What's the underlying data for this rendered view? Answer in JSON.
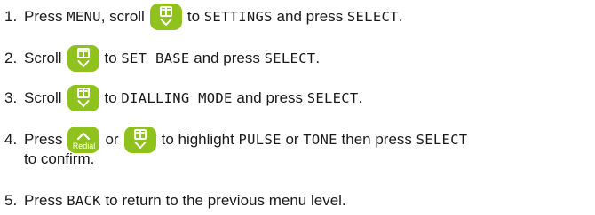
{
  "steps": [
    {
      "number": "1.",
      "t1": "Press ",
      "l1": "MENU",
      "t2": ", scroll",
      "t3": "to ",
      "l2": "SETTINGS",
      "t4": " and press ",
      "l3": "SELECT",
      "t5": "."
    },
    {
      "number": "2.",
      "t1": "Scroll",
      "t2": "to ",
      "l1": "SET BASE",
      "t3": " and press ",
      "l2": "SELECT",
      "t4": "."
    },
    {
      "number": "3.",
      "t1": "Scroll",
      "t2": "to ",
      "l1": "DIALLING MODE",
      "t3": " and press ",
      "l2": "SELECT",
      "t4": "."
    },
    {
      "number": "4.",
      "t1": "Press",
      "t2": "or",
      "t3": "to highlight ",
      "l1": "PULSE",
      "t4": " or ",
      "l2": "TONE",
      "t5": " then press ",
      "l3": "SELECT",
      "t6": "to confirm."
    },
    {
      "number": "5.",
      "t1": "Press ",
      "l1": "BACK",
      "t2": " to return to the previous menu level."
    }
  ],
  "icons": {
    "scroll_key": "phonebook-scroll-down-key-icon",
    "redial_key": "redial-up-key-icon",
    "redial_label": "Redial",
    "key_color": "#8fc21c"
  }
}
